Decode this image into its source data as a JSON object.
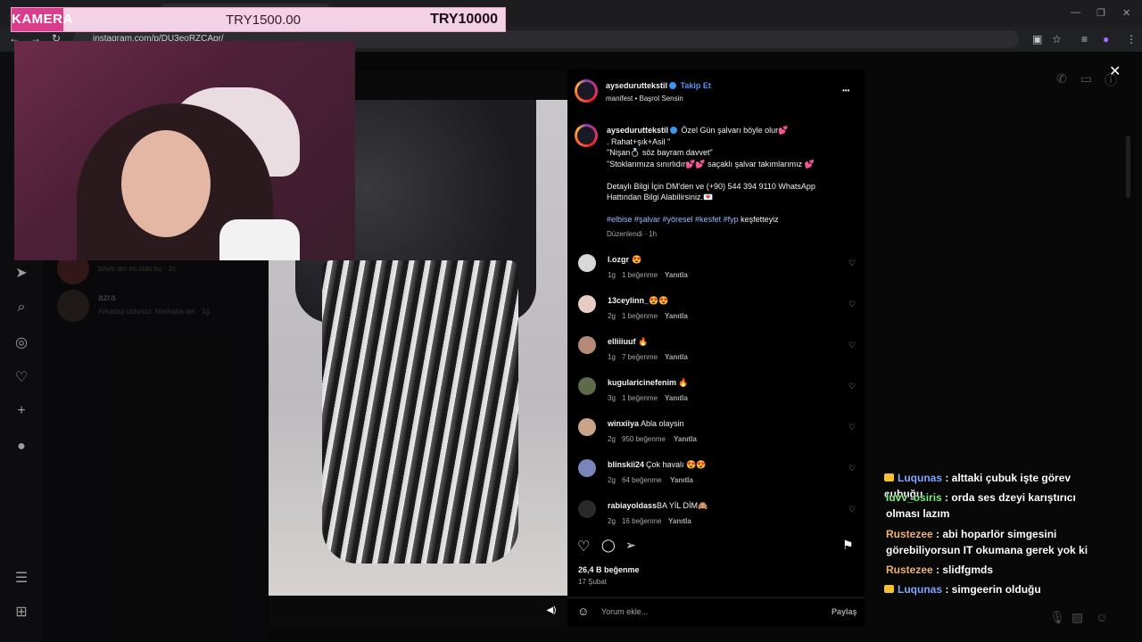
{
  "browser": {
    "url": "instagram.com/p/DU3eoRZCApr/",
    "tab_title": ""
  },
  "donation_bar": {
    "label": "KAMERA",
    "current": "TRY1500.00",
    "goal": "TRY10000",
    "progress_fraction": 0.15
  },
  "inbox": {
    "rows": [
      {
        "name": "",
        "message": "böyle dm mi oldu bu · 2s"
      },
      {
        "name": "azra",
        "message": "Arkadaş oldunuz. Merhaba de! · 1g"
      }
    ]
  },
  "post": {
    "author": "ayseduruttekstil",
    "follow_label": "Takip Et",
    "audio": "manifest • Başrol Sensin",
    "caption_lines": [
      "Özel Gün şalvarı böyle olur💕",
      ". Rahat+şık+Asil \"",
      "\"Nişan💍 söz bayram davvet\"",
      "\"Stoklarımıza sınırlıdır💕💕 saçaklı şalvar takımlarımız 💕",
      "",
      "Detaylı Bilgi İçin DM'den ve (+90) 544 394 9110 WhatsApp",
      "Hattından Bilgi Alabilirsiniz.💌"
    ],
    "hashtags": "#elbise #şalvar #yöresel #kesfet #fyp",
    "hashtag_tail": "keşfetteyiz",
    "edited": "Düzenlendi · 1h",
    "comments": [
      {
        "user": "l.ozgr",
        "text": "😍",
        "time": "1g",
        "likes": "1 beğenme",
        "reply": "Yanıtla"
      },
      {
        "user": "13ceylinn_",
        "text": "😍😍",
        "time": "2g",
        "likes": "1 beğenme",
        "reply": "Yanıtla"
      },
      {
        "user": "elliiiuuf",
        "text": "🔥",
        "time": "1g",
        "likes": "7 beğenme",
        "reply": "Yanıtla"
      },
      {
        "user": "kugularicinefenim",
        "text": "🔥",
        "time": "3g",
        "likes": "1 beğenme",
        "reply": "Yanıtla"
      },
      {
        "user": "winxiiya",
        "text": "Abla olaysin",
        "time": "2g",
        "likes": "950 beğenme",
        "reply": "Yanıtla"
      },
      {
        "user": "blinskii24",
        "text": "Çok havalı 😍😍",
        "time": "2g",
        "likes": "64 beğenme",
        "reply": "Yanıtla"
      },
      {
        "user": "rabiayoldass",
        "text": "BA YİL DİM🙈",
        "time": "2g",
        "likes": "16 beğenme",
        "reply": "Yanıtla"
      }
    ],
    "likes_count": "26,4 B beğenme",
    "date": "17 Şubat",
    "comment_placeholder": "Yorum ekle...",
    "share_label": "Paylaş"
  },
  "chat": [
    {
      "user": "Luqunas",
      "user_color": "#7fa8ff",
      "badge": true,
      "message": ": alttaki çubuk işte görev çubuğu"
    },
    {
      "user": "luvv_osiris",
      "user_color": "#7cf07c",
      "badge": false,
      "message": ": orda ses dzeyi karıştırıcı olması lazım"
    },
    {
      "user": "Rustezee",
      "user_color": "#f0b46a",
      "badge": false,
      "message": ": abi hoparlör simgesini görebiliyorsun IT okumana gerek yok ki"
    },
    {
      "user": "Rustezee",
      "user_color": "#f0b46a",
      "badge": false,
      "message": ": slidfgmds"
    },
    {
      "user": "Luqunas",
      "user_color": "#7fa8ff",
      "badge": true,
      "message": ": simgeerin olduğu"
    }
  ],
  "icons": {
    "back": "←",
    "forward": "→",
    "reload": "↻",
    "close": "✕",
    "heart": "♡",
    "comment": "◯",
    "share": "➢",
    "bookmark": "⚑",
    "more": "•••",
    "mute": "◀)"
  }
}
